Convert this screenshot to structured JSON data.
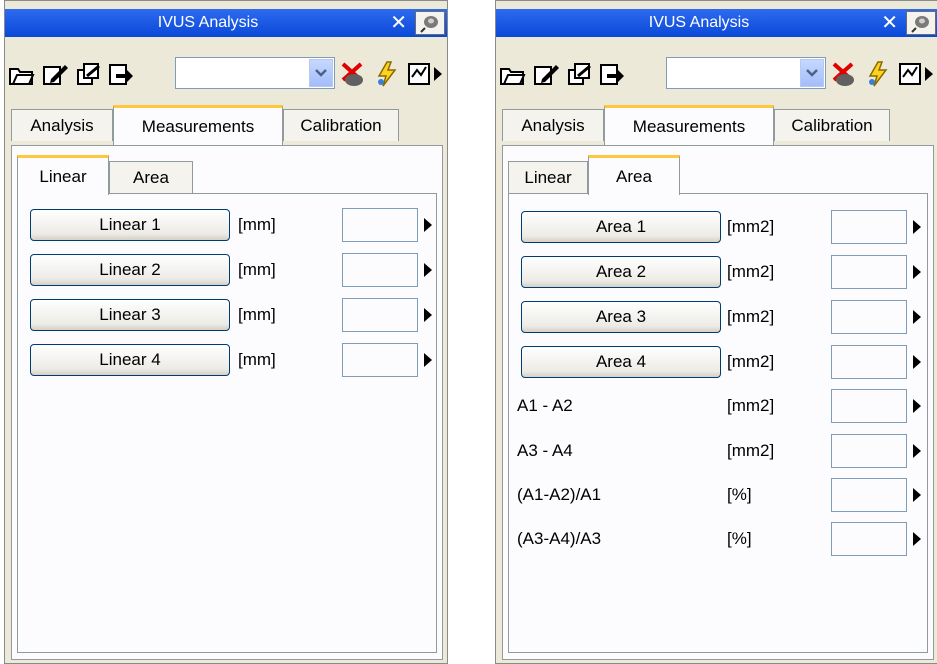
{
  "panels": [
    {
      "title": "IVUS Analysis",
      "close_glyph": "✕",
      "toolbar_icons": [
        "open-folder-icon",
        "edit-icon",
        "copy-icon",
        "export-icon",
        "combo",
        "clear-marker-icon",
        "flash-icon",
        "chart-icon",
        "more-icon"
      ],
      "tabs": [
        "Analysis",
        "Measurements",
        "Calibration"
      ],
      "active_tab": 1,
      "subtabs": [
        "Linear",
        "Area"
      ],
      "active_subtab": 0,
      "rows": [
        {
          "label": "Linear 1",
          "unit": "[mm]",
          "kind": "button"
        },
        {
          "label": "Linear 2",
          "unit": "[mm]",
          "kind": "button"
        },
        {
          "label": "Linear 3",
          "unit": "[mm]",
          "kind": "button"
        },
        {
          "label": "Linear 4",
          "unit": "[mm]",
          "kind": "button"
        }
      ]
    },
    {
      "title": "IVUS Analysis",
      "close_glyph": "✕",
      "toolbar_icons": [
        "open-folder-icon",
        "edit-icon",
        "copy-icon",
        "export-icon",
        "combo",
        "clear-marker-icon",
        "flash-icon",
        "chart-icon",
        "more-icon"
      ],
      "tabs": [
        "Analysis",
        "Measurements",
        "Calibration"
      ],
      "active_tab": 1,
      "subtabs": [
        "Linear",
        "Area"
      ],
      "active_subtab": 1,
      "rows": [
        {
          "label": "Area 1",
          "unit": "[mm2]",
          "kind": "button"
        },
        {
          "label": "Area 2",
          "unit": "[mm2]",
          "kind": "button"
        },
        {
          "label": "Area 3",
          "unit": "[mm2]",
          "kind": "button"
        },
        {
          "label": "Area 4",
          "unit": "[mm2]",
          "kind": "button"
        },
        {
          "label": "A1 - A2",
          "unit": "[mm2]",
          "kind": "label"
        },
        {
          "label": "A3 - A4",
          "unit": "[mm2]",
          "kind": "label"
        },
        {
          "label": "(A1-A2)/A1",
          "unit": "[%]",
          "kind": "label"
        },
        {
          "label": "(A3-A4)/A3",
          "unit": "[%]",
          "kind": "label"
        }
      ]
    }
  ],
  "colors": {
    "titlebar": "#0a48d8",
    "active_tab_accent": "#ffc83c",
    "panel_bg": "#ece9d8",
    "page_bg": "#fcfcfe"
  }
}
